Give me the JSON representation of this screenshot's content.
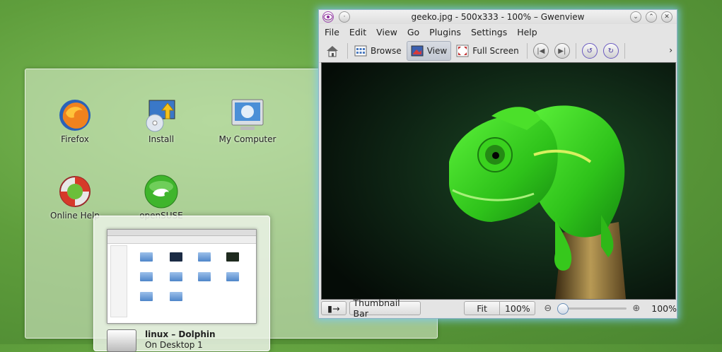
{
  "desktop": {
    "icons": [
      {
        "label": "Firefox"
      },
      {
        "label": "Install"
      },
      {
        "label": "My Computer"
      },
      {
        "label": "Online Help"
      },
      {
        "label": "openSUSE"
      }
    ]
  },
  "task_switcher": {
    "title": "linux – Dolphin",
    "subtitle": "On Desktop 1"
  },
  "window": {
    "title": "geeko.jpg - 500x333 - 100% – Gwenview",
    "menu": [
      "File",
      "Edit",
      "View",
      "Go",
      "Plugins",
      "Settings",
      "Help"
    ],
    "toolbar": {
      "browse": "Browse",
      "view": "View",
      "full_screen": "Full Screen"
    },
    "status": {
      "thumbnail_bar": "Thumbnail Bar",
      "fit": "Fit",
      "zoom_field": "100%",
      "zoom_label": "100%"
    }
  },
  "colors": {
    "accent_glow": "#78c8f0",
    "desktop_green": "#5f9e3c",
    "geeko_green": "#3ed21e"
  }
}
